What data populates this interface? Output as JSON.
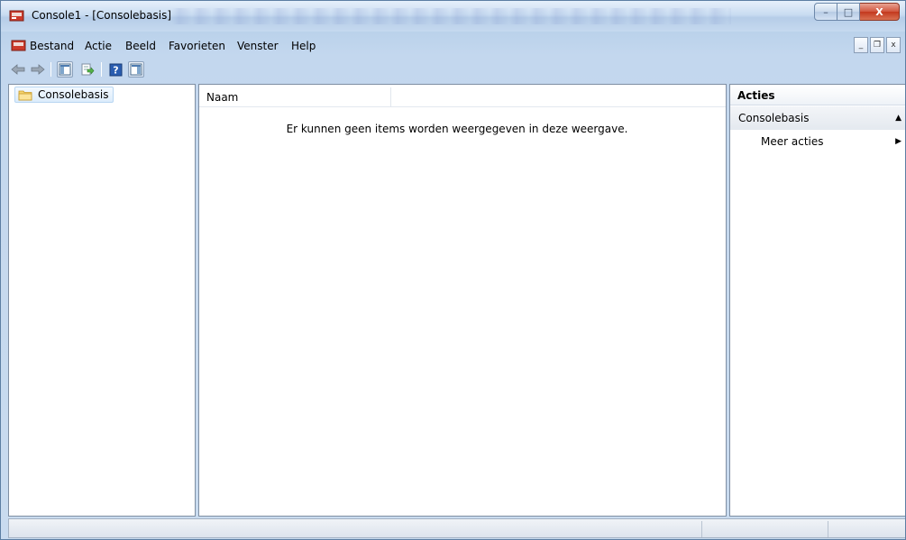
{
  "window": {
    "title": "Console1 - [Consolebasis]",
    "controls": {
      "minimize": "–",
      "maximize": "□",
      "close": "X"
    }
  },
  "menubar": {
    "items": [
      "Bestand",
      "Actie",
      "Beeld",
      "Favorieten",
      "Venster",
      "Help"
    ],
    "mdi_controls": {
      "minimize": "_",
      "restore": "❐",
      "close": "x"
    }
  },
  "toolbar": {
    "buttons": [
      "back-icon",
      "forward-icon",
      "show-hide-tree-icon",
      "export-list-icon",
      "help-icon",
      "show-hide-action-pane-icon"
    ]
  },
  "tree": {
    "root_label": "Consolebasis"
  },
  "list": {
    "columns": [
      "Naam",
      ""
    ],
    "empty_message": "Er kunnen geen items worden weergegeven in deze weergave."
  },
  "actions_pane": {
    "header": "Acties",
    "section": "Consolebasis",
    "items": [
      "Meer acties"
    ]
  },
  "colors": {
    "titlebar": "#c9dcf1",
    "close_button": "#c3381d",
    "selection": "#dcecfb"
  }
}
